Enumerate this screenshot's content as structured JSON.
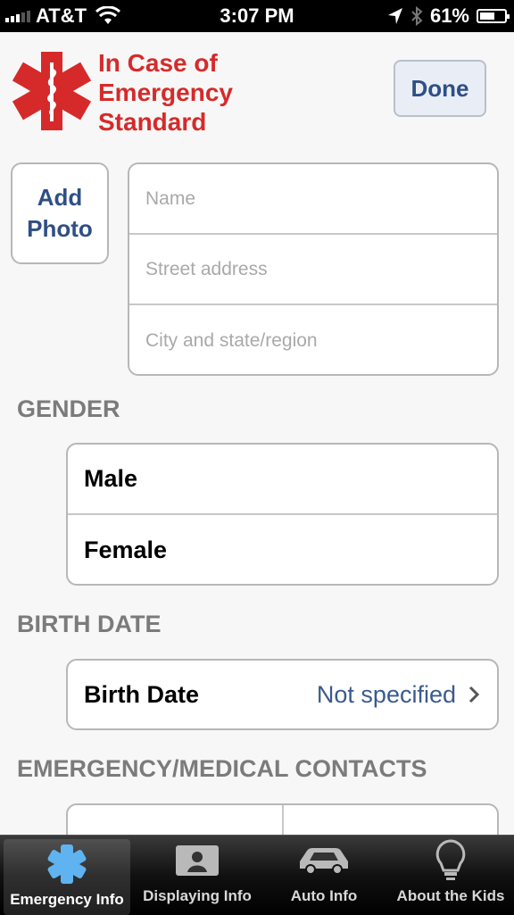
{
  "status_bar": {
    "carrier": "AT&T",
    "time": "3:07 PM",
    "battery": "61%",
    "battery_level": 0.61,
    "icons": [
      "signal-icon",
      "wifi-icon",
      "location-arrow-icon",
      "bluetooth-icon",
      "battery-icon"
    ]
  },
  "header": {
    "title_lines": [
      "In Case of",
      "Emergency",
      "Standard"
    ],
    "done_label": "Done",
    "logo_icon": "star-of-life-icon",
    "brand_color": "#d62a2a"
  },
  "identity": {
    "add_photo_lines": [
      "Add",
      "Photo"
    ],
    "name_placeholder": "Name",
    "street_placeholder": "Street address",
    "city_placeholder": "City and state/region"
  },
  "gender": {
    "label": "GENDER",
    "options": [
      "Male",
      "Female"
    ]
  },
  "birth": {
    "section_label": "BIRTH DATE",
    "row_label": "Birth Date",
    "value": "Not specified"
  },
  "contacts": {
    "label": "EMERGENCY/MEDICAL CONTACTS"
  },
  "tabbar": {
    "tabs": [
      {
        "label": "Emergency Info",
        "icon": "medical-star-icon",
        "active": true
      },
      {
        "label": "Displaying Info",
        "icon": "contact-card-icon",
        "active": false
      },
      {
        "label": "Auto Info",
        "icon": "car-icon",
        "active": false
      },
      {
        "label": "About the Kids",
        "icon": "lightbulb-icon",
        "active": false
      }
    ]
  }
}
